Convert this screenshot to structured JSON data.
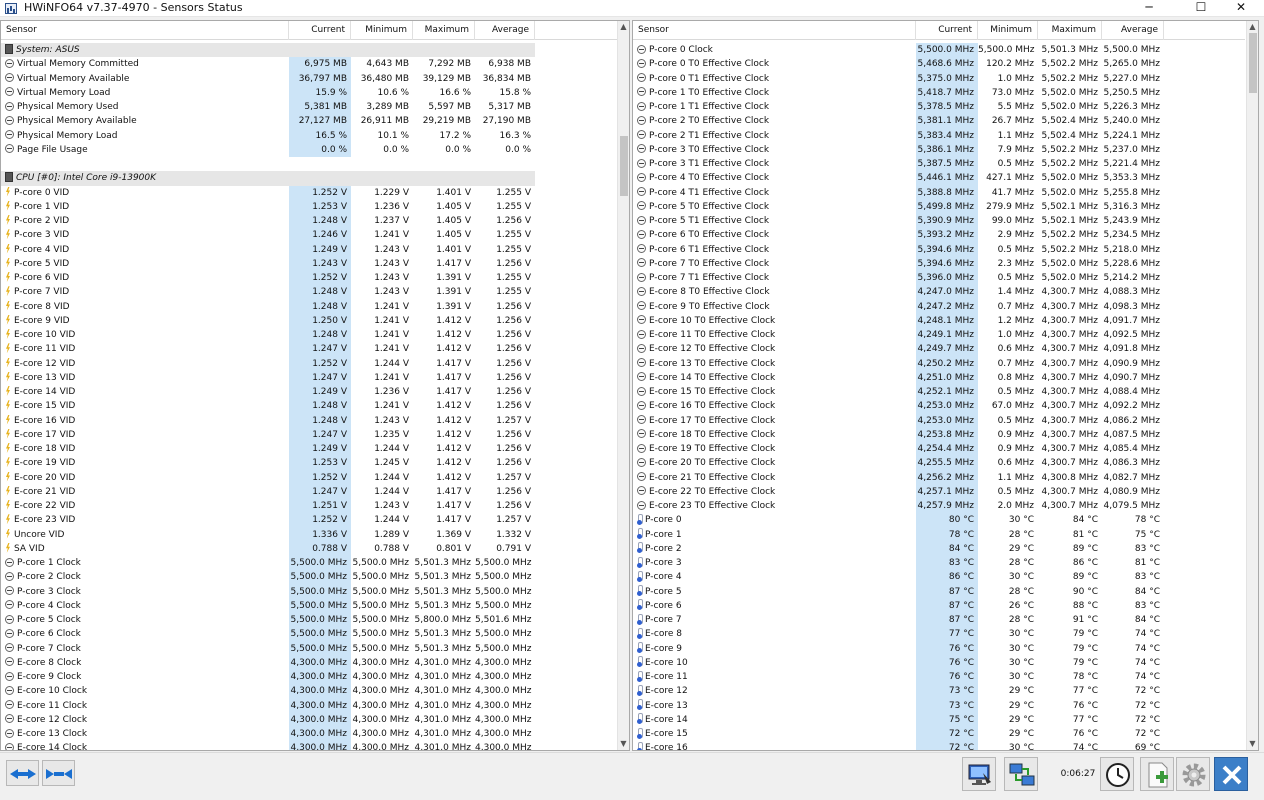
{
  "window": {
    "title": "HWiNFO64 v7.37-4970 - Sensors Status",
    "minimize": "─",
    "maximize": "☐",
    "close": "✕"
  },
  "columns": {
    "sensor": "Sensor",
    "current": "Current",
    "minimum": "Minimum",
    "maximum": "Maximum",
    "average": "Average"
  },
  "left_rows": [
    {
      "type": "group",
      "icon": "chip",
      "name": "System: ASUS"
    },
    {
      "icon": "clock",
      "name": "Virtual Memory Committed",
      "cur": "6,975 MB",
      "min": "4,643 MB",
      "max": "7,292 MB",
      "avg": "6,938 MB"
    },
    {
      "icon": "clock",
      "name": "Virtual Memory Available",
      "cur": "36,797 MB",
      "min": "36,480 MB",
      "max": "39,129 MB",
      "avg": "36,834 MB"
    },
    {
      "icon": "clock",
      "name": "Virtual Memory Load",
      "cur": "15.9 %",
      "min": "10.6 %",
      "max": "16.6 %",
      "avg": "15.8 %"
    },
    {
      "icon": "clock",
      "name": "Physical Memory Used",
      "cur": "5,381 MB",
      "min": "3,289 MB",
      "max": "5,597 MB",
      "avg": "5,317 MB"
    },
    {
      "icon": "clock",
      "name": "Physical Memory Available",
      "cur": "27,127 MB",
      "min": "26,911 MB",
      "max": "29,219 MB",
      "avg": "27,190 MB"
    },
    {
      "icon": "clock",
      "name": "Physical Memory Load",
      "cur": "16.5 %",
      "min": "10.1 %",
      "max": "17.2 %",
      "avg": "16.3 %"
    },
    {
      "icon": "clock",
      "name": "Page File Usage",
      "cur": "0.0 %",
      "min": "0.0 %",
      "max": "0.0 %",
      "avg": "0.0 %"
    },
    {
      "type": "blank"
    },
    {
      "type": "group",
      "icon": "chip",
      "name": "CPU [#0]: Intel Core i9-13900K"
    },
    {
      "icon": "volt",
      "name": "P-core 0 VID",
      "cur": "1.252 V",
      "min": "1.229 V",
      "max": "1.401 V",
      "avg": "1.255 V"
    },
    {
      "icon": "volt",
      "name": "P-core 1 VID",
      "cur": "1.253 V",
      "min": "1.236 V",
      "max": "1.405 V",
      "avg": "1.255 V"
    },
    {
      "icon": "volt",
      "name": "P-core 2 VID",
      "cur": "1.248 V",
      "min": "1.237 V",
      "max": "1.405 V",
      "avg": "1.256 V"
    },
    {
      "icon": "volt",
      "name": "P-core 3 VID",
      "cur": "1.246 V",
      "min": "1.241 V",
      "max": "1.405 V",
      "avg": "1.255 V"
    },
    {
      "icon": "volt",
      "name": "P-core 4 VID",
      "cur": "1.249 V",
      "min": "1.243 V",
      "max": "1.401 V",
      "avg": "1.255 V"
    },
    {
      "icon": "volt",
      "name": "P-core 5 VID",
      "cur": "1.243 V",
      "min": "1.243 V",
      "max": "1.417 V",
      "avg": "1.256 V"
    },
    {
      "icon": "volt",
      "name": "P-core 6 VID",
      "cur": "1.252 V",
      "min": "1.243 V",
      "max": "1.391 V",
      "avg": "1.255 V"
    },
    {
      "icon": "volt",
      "name": "P-core 7 VID",
      "cur": "1.248 V",
      "min": "1.243 V",
      "max": "1.391 V",
      "avg": "1.255 V"
    },
    {
      "icon": "volt",
      "name": "E-core 8 VID",
      "cur": "1.248 V",
      "min": "1.241 V",
      "max": "1.391 V",
      "avg": "1.256 V"
    },
    {
      "icon": "volt",
      "name": "E-core 9 VID",
      "cur": "1.250 V",
      "min": "1.241 V",
      "max": "1.412 V",
      "avg": "1.256 V"
    },
    {
      "icon": "volt",
      "name": "E-core 10 VID",
      "cur": "1.248 V",
      "min": "1.241 V",
      "max": "1.412 V",
      "avg": "1.256 V"
    },
    {
      "icon": "volt",
      "name": "E-core 11 VID",
      "cur": "1.247 V",
      "min": "1.241 V",
      "max": "1.412 V",
      "avg": "1.256 V"
    },
    {
      "icon": "volt",
      "name": "E-core 12 VID",
      "cur": "1.252 V",
      "min": "1.244 V",
      "max": "1.417 V",
      "avg": "1.256 V"
    },
    {
      "icon": "volt",
      "name": "E-core 13 VID",
      "cur": "1.247 V",
      "min": "1.241 V",
      "max": "1.417 V",
      "avg": "1.256 V"
    },
    {
      "icon": "volt",
      "name": "E-core 14 VID",
      "cur": "1.249 V",
      "min": "1.236 V",
      "max": "1.417 V",
      "avg": "1.256 V"
    },
    {
      "icon": "volt",
      "name": "E-core 15 VID",
      "cur": "1.248 V",
      "min": "1.241 V",
      "max": "1.412 V",
      "avg": "1.256 V"
    },
    {
      "icon": "volt",
      "name": "E-core 16 VID",
      "cur": "1.248 V",
      "min": "1.243 V",
      "max": "1.412 V",
      "avg": "1.257 V"
    },
    {
      "icon": "volt",
      "name": "E-core 17 VID",
      "cur": "1.247 V",
      "min": "1.235 V",
      "max": "1.412 V",
      "avg": "1.256 V"
    },
    {
      "icon": "volt",
      "name": "E-core 18 VID",
      "cur": "1.249 V",
      "min": "1.244 V",
      "max": "1.412 V",
      "avg": "1.256 V"
    },
    {
      "icon": "volt",
      "name": "E-core 19 VID",
      "cur": "1.253 V",
      "min": "1.245 V",
      "max": "1.412 V",
      "avg": "1.256 V"
    },
    {
      "icon": "volt",
      "name": "E-core 20 VID",
      "cur": "1.252 V",
      "min": "1.244 V",
      "max": "1.412 V",
      "avg": "1.257 V"
    },
    {
      "icon": "volt",
      "name": "E-core 21 VID",
      "cur": "1.247 V",
      "min": "1.244 V",
      "max": "1.417 V",
      "avg": "1.256 V"
    },
    {
      "icon": "volt",
      "name": "E-core 22 VID",
      "cur": "1.251 V",
      "min": "1.243 V",
      "max": "1.417 V",
      "avg": "1.256 V"
    },
    {
      "icon": "volt",
      "name": "E-core 23 VID",
      "cur": "1.252 V",
      "min": "1.244 V",
      "max": "1.417 V",
      "avg": "1.257 V"
    },
    {
      "icon": "volt",
      "name": "Uncore VID",
      "cur": "1.336 V",
      "min": "1.289 V",
      "max": "1.369 V",
      "avg": "1.332 V"
    },
    {
      "icon": "volt",
      "name": "SA VID",
      "cur": "0.788 V",
      "min": "0.788 V",
      "max": "0.801 V",
      "avg": "0.791 V"
    },
    {
      "icon": "clock",
      "name": "P-core 1 Clock",
      "cur": "5,500.0 MHz",
      "min": "5,500.0 MHz",
      "max": "5,501.3 MHz",
      "avg": "5,500.0 MHz"
    },
    {
      "icon": "clock",
      "name": "P-core 2 Clock",
      "cur": "5,500.0 MHz",
      "min": "5,500.0 MHz",
      "max": "5,501.3 MHz",
      "avg": "5,500.0 MHz"
    },
    {
      "icon": "clock",
      "name": "P-core 3 Clock",
      "cur": "5,500.0 MHz",
      "min": "5,500.0 MHz",
      "max": "5,501.3 MHz",
      "avg": "5,500.0 MHz"
    },
    {
      "icon": "clock",
      "name": "P-core 4 Clock",
      "cur": "5,500.0 MHz",
      "min": "5,500.0 MHz",
      "max": "5,501.3 MHz",
      "avg": "5,500.0 MHz"
    },
    {
      "icon": "clock",
      "name": "P-core 5 Clock",
      "cur": "5,500.0 MHz",
      "min": "5,500.0 MHz",
      "max": "5,800.0 MHz",
      "avg": "5,501.6 MHz"
    },
    {
      "icon": "clock",
      "name": "P-core 6 Clock",
      "cur": "5,500.0 MHz",
      "min": "5,500.0 MHz",
      "max": "5,501.3 MHz",
      "avg": "5,500.0 MHz"
    },
    {
      "icon": "clock",
      "name": "P-core 7 Clock",
      "cur": "5,500.0 MHz",
      "min": "5,500.0 MHz",
      "max": "5,501.3 MHz",
      "avg": "5,500.0 MHz"
    },
    {
      "icon": "clock",
      "name": "E-core 8 Clock",
      "cur": "4,300.0 MHz",
      "min": "4,300.0 MHz",
      "max": "4,301.0 MHz",
      "avg": "4,300.0 MHz"
    },
    {
      "icon": "clock",
      "name": "E-core 9 Clock",
      "cur": "4,300.0 MHz",
      "min": "4,300.0 MHz",
      "max": "4,301.0 MHz",
      "avg": "4,300.0 MHz"
    },
    {
      "icon": "clock",
      "name": "E-core 10 Clock",
      "cur": "4,300.0 MHz",
      "min": "4,300.0 MHz",
      "max": "4,301.0 MHz",
      "avg": "4,300.0 MHz"
    },
    {
      "icon": "clock",
      "name": "E-core 11 Clock",
      "cur": "4,300.0 MHz",
      "min": "4,300.0 MHz",
      "max": "4,301.0 MHz",
      "avg": "4,300.0 MHz"
    },
    {
      "icon": "clock",
      "name": "E-core 12 Clock",
      "cur": "4,300.0 MHz",
      "min": "4,300.0 MHz",
      "max": "4,301.0 MHz",
      "avg": "4,300.0 MHz"
    },
    {
      "icon": "clock",
      "name": "E-core 13 Clock",
      "cur": "4,300.0 MHz",
      "min": "4,300.0 MHz",
      "max": "4,301.0 MHz",
      "avg": "4,300.0 MHz"
    },
    {
      "icon": "clock",
      "name": "E-core 14 Clock",
      "cur": "4,300.0 MHz",
      "min": "4,300.0 MHz",
      "max": "4,301.0 MHz",
      "avg": "4,300.0 MHz"
    }
  ],
  "right_rows": [
    {
      "icon": "clock",
      "name": "P-core 0 Clock",
      "cur": "5,500.0 MHz",
      "min": "5,500.0 MHz",
      "max": "5,501.3 MHz",
      "avg": "5,500.0 MHz"
    },
    {
      "icon": "clock",
      "name": "P-core 0 T0 Effective Clock",
      "cur": "5,468.6 MHz",
      "min": "120.2 MHz",
      "max": "5,502.2 MHz",
      "avg": "5,265.0 MHz"
    },
    {
      "icon": "clock",
      "name": "P-core 0 T1 Effective Clock",
      "cur": "5,375.0 MHz",
      "min": "1.0 MHz",
      "max": "5,502.2 MHz",
      "avg": "5,227.0 MHz"
    },
    {
      "icon": "clock",
      "name": "P-core 1 T0 Effective Clock",
      "cur": "5,418.7 MHz",
      "min": "73.0 MHz",
      "max": "5,502.0 MHz",
      "avg": "5,250.5 MHz"
    },
    {
      "icon": "clock",
      "name": "P-core 1 T1 Effective Clock",
      "cur": "5,378.5 MHz",
      "min": "5.5 MHz",
      "max": "5,502.0 MHz",
      "avg": "5,226.3 MHz"
    },
    {
      "icon": "clock",
      "name": "P-core 2 T0 Effective Clock",
      "cur": "5,381.1 MHz",
      "min": "26.7 MHz",
      "max": "5,502.4 MHz",
      "avg": "5,240.0 MHz"
    },
    {
      "icon": "clock",
      "name": "P-core 2 T1 Effective Clock",
      "cur": "5,383.4 MHz",
      "min": "1.1 MHz",
      "max": "5,502.4 MHz",
      "avg": "5,224.1 MHz"
    },
    {
      "icon": "clock",
      "name": "P-core 3 T0 Effective Clock",
      "cur": "5,386.1 MHz",
      "min": "7.9 MHz",
      "max": "5,502.2 MHz",
      "avg": "5,237.0 MHz"
    },
    {
      "icon": "clock",
      "name": "P-core 3 T1 Effective Clock",
      "cur": "5,387.5 MHz",
      "min": "0.5 MHz",
      "max": "5,502.2 MHz",
      "avg": "5,221.4 MHz"
    },
    {
      "icon": "clock",
      "name": "P-core 4 T0 Effective Clock",
      "cur": "5,446.1 MHz",
      "min": "427.1 MHz",
      "max": "5,502.0 MHz",
      "avg": "5,353.3 MHz"
    },
    {
      "icon": "clock",
      "name": "P-core 4 T1 Effective Clock",
      "cur": "5,388.8 MHz",
      "min": "41.7 MHz",
      "max": "5,502.0 MHz",
      "avg": "5,255.8 MHz"
    },
    {
      "icon": "clock",
      "name": "P-core 5 T0 Effective Clock",
      "cur": "5,499.8 MHz",
      "min": "279.9 MHz",
      "max": "5,502.1 MHz",
      "avg": "5,316.3 MHz"
    },
    {
      "icon": "clock",
      "name": "P-core 5 T1 Effective Clock",
      "cur": "5,390.9 MHz",
      "min": "99.0 MHz",
      "max": "5,502.1 MHz",
      "avg": "5,243.9 MHz"
    },
    {
      "icon": "clock",
      "name": "P-core 6 T0 Effective Clock",
      "cur": "5,393.2 MHz",
      "min": "2.9 MHz",
      "max": "5,502.2 MHz",
      "avg": "5,234.5 MHz"
    },
    {
      "icon": "clock",
      "name": "P-core 6 T1 Effective Clock",
      "cur": "5,394.6 MHz",
      "min": "0.5 MHz",
      "max": "5,502.2 MHz",
      "avg": "5,218.0 MHz"
    },
    {
      "icon": "clock",
      "name": "P-core 7 T0 Effective Clock",
      "cur": "5,394.6 MHz",
      "min": "2.3 MHz",
      "max": "5,502.0 MHz",
      "avg": "5,228.6 MHz"
    },
    {
      "icon": "clock",
      "name": "P-core 7 T1 Effective Clock",
      "cur": "5,396.0 MHz",
      "min": "0.5 MHz",
      "max": "5,502.0 MHz",
      "avg": "5,214.2 MHz"
    },
    {
      "icon": "clock",
      "name": "E-core 8 T0 Effective Clock",
      "cur": "4,247.0 MHz",
      "min": "1.4 MHz",
      "max": "4,300.7 MHz",
      "avg": "4,088.3 MHz"
    },
    {
      "icon": "clock",
      "name": "E-core 9 T0 Effective Clock",
      "cur": "4,247.2 MHz",
      "min": "0.7 MHz",
      "max": "4,300.7 MHz",
      "avg": "4,098.3 MHz"
    },
    {
      "icon": "clock",
      "name": "E-core 10 T0 Effective Clock",
      "cur": "4,248.1 MHz",
      "min": "1.2 MHz",
      "max": "4,300.7 MHz",
      "avg": "4,091.7 MHz"
    },
    {
      "icon": "clock",
      "name": "E-core 11 T0 Effective Clock",
      "cur": "4,249.1 MHz",
      "min": "1.0 MHz",
      "max": "4,300.7 MHz",
      "avg": "4,092.5 MHz"
    },
    {
      "icon": "clock",
      "name": "E-core 12 T0 Effective Clock",
      "cur": "4,249.7 MHz",
      "min": "0.6 MHz",
      "max": "4,300.7 MHz",
      "avg": "4,091.8 MHz"
    },
    {
      "icon": "clock",
      "name": "E-core 13 T0 Effective Clock",
      "cur": "4,250.2 MHz",
      "min": "0.7 MHz",
      "max": "4,300.7 MHz",
      "avg": "4,090.9 MHz"
    },
    {
      "icon": "clock",
      "name": "E-core 14 T0 Effective Clock",
      "cur": "4,251.0 MHz",
      "min": "0.8 MHz",
      "max": "4,300.7 MHz",
      "avg": "4,090.7 MHz"
    },
    {
      "icon": "clock",
      "name": "E-core 15 T0 Effective Clock",
      "cur": "4,252.1 MHz",
      "min": "0.5 MHz",
      "max": "4,300.7 MHz",
      "avg": "4,088.4 MHz"
    },
    {
      "icon": "clock",
      "name": "E-core 16 T0 Effective Clock",
      "cur": "4,253.0 MHz",
      "min": "67.0 MHz",
      "max": "4,300.7 MHz",
      "avg": "4,092.2 MHz"
    },
    {
      "icon": "clock",
      "name": "E-core 17 T0 Effective Clock",
      "cur": "4,253.0 MHz",
      "min": "0.5 MHz",
      "max": "4,300.7 MHz",
      "avg": "4,086.2 MHz"
    },
    {
      "icon": "clock",
      "name": "E-core 18 T0 Effective Clock",
      "cur": "4,253.8 MHz",
      "min": "0.9 MHz",
      "max": "4,300.7 MHz",
      "avg": "4,087.5 MHz"
    },
    {
      "icon": "clock",
      "name": "E-core 19 T0 Effective Clock",
      "cur": "4,254.4 MHz",
      "min": "0.9 MHz",
      "max": "4,300.7 MHz",
      "avg": "4,085.4 MHz"
    },
    {
      "icon": "clock",
      "name": "E-core 20 T0 Effective Clock",
      "cur": "4,255.5 MHz",
      "min": "0.6 MHz",
      "max": "4,300.7 MHz",
      "avg": "4,086.3 MHz"
    },
    {
      "icon": "clock",
      "name": "E-core 21 T0 Effective Clock",
      "cur": "4,256.2 MHz",
      "min": "1.1 MHz",
      "max": "4,300.8 MHz",
      "avg": "4,082.7 MHz"
    },
    {
      "icon": "clock",
      "name": "E-core 22 T0 Effective Clock",
      "cur": "4,257.1 MHz",
      "min": "0.5 MHz",
      "max": "4,300.7 MHz",
      "avg": "4,080.9 MHz"
    },
    {
      "icon": "clock",
      "name": "E-core 23 T0 Effective Clock",
      "cur": "4,257.9 MHz",
      "min": "2.0 MHz",
      "max": "4,300.7 MHz",
      "avg": "4,079.5 MHz"
    },
    {
      "icon": "therm",
      "name": "P-core 0",
      "cur": "80 °C",
      "min": "30 °C",
      "max": "84 °C",
      "avg": "78 °C"
    },
    {
      "icon": "therm",
      "name": "P-core 1",
      "cur": "78 °C",
      "min": "28 °C",
      "max": "81 °C",
      "avg": "75 °C"
    },
    {
      "icon": "therm",
      "name": "P-core 2",
      "cur": "84 °C",
      "min": "29 °C",
      "max": "89 °C",
      "avg": "83 °C"
    },
    {
      "icon": "therm",
      "name": "P-core 3",
      "cur": "83 °C",
      "min": "28 °C",
      "max": "86 °C",
      "avg": "81 °C"
    },
    {
      "icon": "therm",
      "name": "P-core 4",
      "cur": "86 °C",
      "min": "30 °C",
      "max": "89 °C",
      "avg": "83 °C"
    },
    {
      "icon": "therm",
      "name": "P-core 5",
      "cur": "87 °C",
      "min": "28 °C",
      "max": "90 °C",
      "avg": "84 °C"
    },
    {
      "icon": "therm",
      "name": "P-core 6",
      "cur": "87 °C",
      "min": "26 °C",
      "max": "88 °C",
      "avg": "83 °C"
    },
    {
      "icon": "therm",
      "name": "P-core 7",
      "cur": "87 °C",
      "min": "28 °C",
      "max": "91 °C",
      "avg": "84 °C"
    },
    {
      "icon": "therm",
      "name": "E-core 8",
      "cur": "77 °C",
      "min": "30 °C",
      "max": "79 °C",
      "avg": "74 °C"
    },
    {
      "icon": "therm",
      "name": "E-core 9",
      "cur": "76 °C",
      "min": "30 °C",
      "max": "79 °C",
      "avg": "74 °C"
    },
    {
      "icon": "therm",
      "name": "E-core 10",
      "cur": "76 °C",
      "min": "30 °C",
      "max": "79 °C",
      "avg": "74 °C"
    },
    {
      "icon": "therm",
      "name": "E-core 11",
      "cur": "76 °C",
      "min": "30 °C",
      "max": "78 °C",
      "avg": "74 °C"
    },
    {
      "icon": "therm",
      "name": "E-core 12",
      "cur": "73 °C",
      "min": "29 °C",
      "max": "77 °C",
      "avg": "72 °C"
    },
    {
      "icon": "therm",
      "name": "E-core 13",
      "cur": "73 °C",
      "min": "29 °C",
      "max": "76 °C",
      "avg": "72 °C"
    },
    {
      "icon": "therm",
      "name": "E-core 14",
      "cur": "75 °C",
      "min": "29 °C",
      "max": "77 °C",
      "avg": "72 °C"
    },
    {
      "icon": "therm",
      "name": "E-core 15",
      "cur": "72 °C",
      "min": "29 °C",
      "max": "76 °C",
      "avg": "72 °C"
    },
    {
      "icon": "therm",
      "name": "E-core 16",
      "cur": "72 °C",
      "min": "30 °C",
      "max": "74 °C",
      "avg": "69 °C"
    }
  ],
  "scroll": {
    "left_position": 0.16,
    "right_position": 0.0
  },
  "toolbar": {
    "elapsed": "0:06:27",
    "icons": [
      "arrows-expand-icon",
      "arrows-collapse-icon",
      "monitor-report-icon",
      "network-icon",
      "clock-reset-icon",
      "add-log-icon",
      "gear-icon",
      "close-icon"
    ]
  },
  "colors": {
    "current_highlight": "#cce4f7",
    "group_bg": "#e6e6e6",
    "close_button": "#3c7fc8"
  }
}
